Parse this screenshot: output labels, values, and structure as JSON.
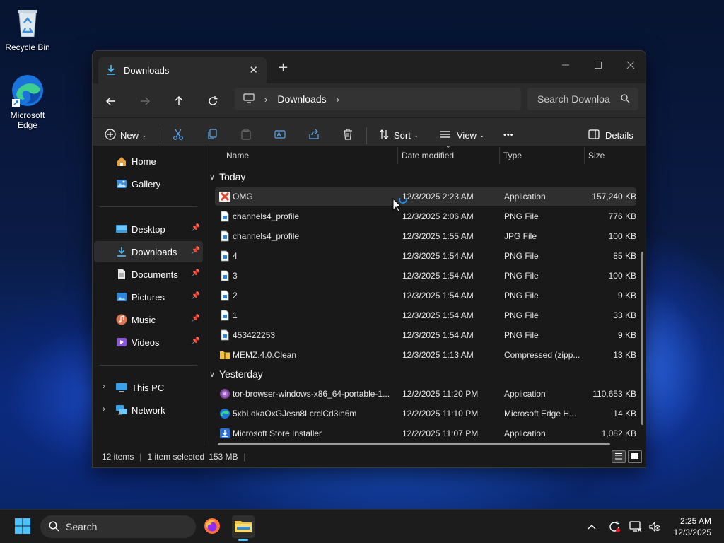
{
  "desktop": {
    "icons": [
      {
        "label": "Recycle Bin",
        "icon": "recycle-bin-icon"
      },
      {
        "label": "Microsoft Edge",
        "icon": "edge-icon"
      }
    ]
  },
  "window": {
    "tab_title": "Downloads",
    "new_tab_symbol": "+",
    "breadcrumb": [
      "Downloads"
    ],
    "search_placeholder": "Search Downloa",
    "toolbar": {
      "new_label": "New",
      "sort_label": "Sort",
      "view_label": "View",
      "more_label": "•••",
      "details_label": "Details"
    },
    "sidebar": {
      "top": [
        {
          "label": "Home",
          "icon": "home-icon"
        },
        {
          "label": "Gallery",
          "icon": "gallery-icon"
        }
      ],
      "pinned": [
        {
          "label": "Desktop",
          "icon": "desktop-icon"
        },
        {
          "label": "Downloads",
          "icon": "downloads-icon",
          "selected": true
        },
        {
          "label": "Documents",
          "icon": "documents-icon"
        },
        {
          "label": "Pictures",
          "icon": "pictures-icon"
        },
        {
          "label": "Music",
          "icon": "music-icon"
        },
        {
          "label": "Videos",
          "icon": "videos-icon"
        }
      ],
      "bottom": [
        {
          "label": "This PC",
          "icon": "this-pc-icon"
        },
        {
          "label": "Network",
          "icon": "network-icon"
        }
      ]
    },
    "columns": {
      "name": "Name",
      "date": "Date modified",
      "type": "Type",
      "size": "Size"
    },
    "groups": [
      {
        "label": "Today",
        "files": [
          {
            "name": "OMG",
            "date": "12/3/2025 2:23 AM",
            "type": "Application",
            "size": "157,240 KB",
            "icon": "error-app-icon",
            "selected": true
          },
          {
            "name": "channels4_profile",
            "date": "12/3/2025 2:06 AM",
            "type": "PNG File",
            "size": "776 KB",
            "icon": "image-file-icon"
          },
          {
            "name": "channels4_profile",
            "date": "12/3/2025 1:55 AM",
            "type": "JPG File",
            "size": "100 KB",
            "icon": "image-file-icon"
          },
          {
            "name": "4",
            "date": "12/3/2025 1:54 AM",
            "type": "PNG File",
            "size": "85 KB",
            "icon": "image-file-icon"
          },
          {
            "name": "3",
            "date": "12/3/2025 1:54 AM",
            "type": "PNG File",
            "size": "100 KB",
            "icon": "image-file-icon"
          },
          {
            "name": "2",
            "date": "12/3/2025 1:54 AM",
            "type": "PNG File",
            "size": "9 KB",
            "icon": "image-file-icon"
          },
          {
            "name": "1",
            "date": "12/3/2025 1:54 AM",
            "type": "PNG File",
            "size": "33 KB",
            "icon": "image-file-icon"
          },
          {
            "name": "453422253",
            "date": "12/3/2025 1:54 AM",
            "type": "PNG File",
            "size": "9 KB",
            "icon": "image-file-icon"
          },
          {
            "name": "MEMZ.4.0.Clean",
            "date": "12/3/2025 1:13 AM",
            "type": "Compressed (zipp...",
            "size": "13 KB",
            "icon": "zip-folder-icon"
          }
        ]
      },
      {
        "label": "Yesterday",
        "files": [
          {
            "name": "tor-browser-windows-x86_64-portable-1...",
            "date": "12/2/2025 11:20 PM",
            "type": "Application",
            "size": "110,653 KB",
            "icon": "tor-icon"
          },
          {
            "name": "5xbLdkaOxGJesn8LcrclCd3in6m",
            "date": "12/2/2025 11:10 PM",
            "type": "Microsoft Edge H...",
            "size": "14 KB",
            "icon": "edge-file-icon"
          },
          {
            "name": "Microsoft Store Installer",
            "date": "12/2/2025 11:07 PM",
            "type": "Application",
            "size": "1,082 KB",
            "icon": "installer-icon"
          }
        ]
      }
    ],
    "status": {
      "items": "12 items",
      "selected": "1 item selected",
      "size": "153 MB"
    }
  },
  "taskbar": {
    "search_label": "Search",
    "time": "2:25 AM",
    "date": "12/3/2025"
  },
  "colors": {
    "accent": "#4cc2ff",
    "window_bg": "#191919",
    "toolbar_bg": "#2b2b2b",
    "taskbar_bg": "#1c1c1c"
  }
}
